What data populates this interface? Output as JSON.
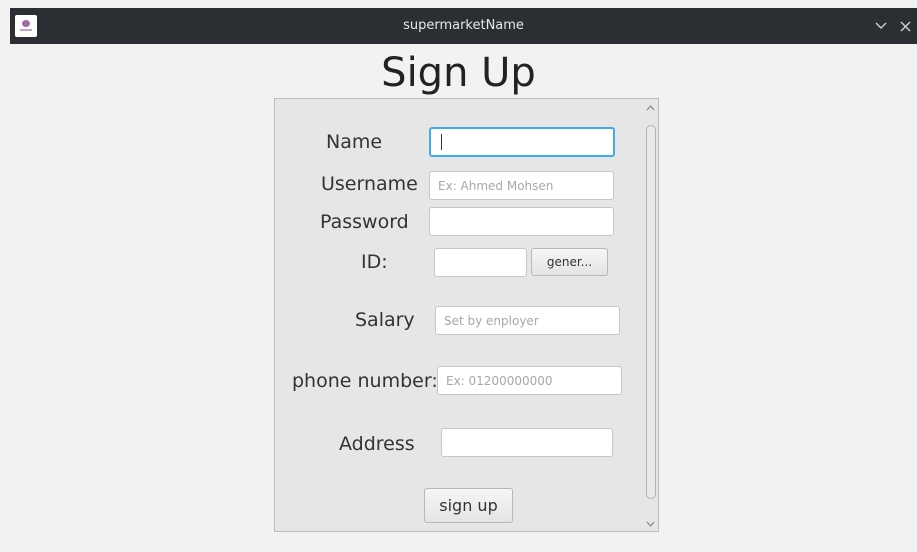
{
  "window": {
    "title": "supermarketName",
    "icon": "app-logo-icon",
    "controls": [
      "chevron-down-icon",
      "close-icon"
    ]
  },
  "page": {
    "heading": "Sign Up"
  },
  "form": {
    "name": {
      "label": "Name",
      "value": "",
      "placeholder": ""
    },
    "username": {
      "label": "Username",
      "value": "",
      "placeholder": "Ex: Ahmed Mohsen"
    },
    "password": {
      "label": "Password",
      "value": "",
      "placeholder": ""
    },
    "id": {
      "label": "ID:",
      "value": "",
      "placeholder": "",
      "generate_label": "gener..."
    },
    "salary": {
      "label": "Salary",
      "value": "",
      "placeholder": "Set by enployer"
    },
    "phone": {
      "label": "phone number:",
      "value": "",
      "placeholder": "Ex: 01200000000"
    },
    "address": {
      "label": "Address",
      "value": "",
      "placeholder": ""
    },
    "submit_label": "sign up"
  },
  "colors": {
    "titlebar": "#2b2e33",
    "focus": "#3daee9",
    "panel": "#e6e6e6"
  }
}
